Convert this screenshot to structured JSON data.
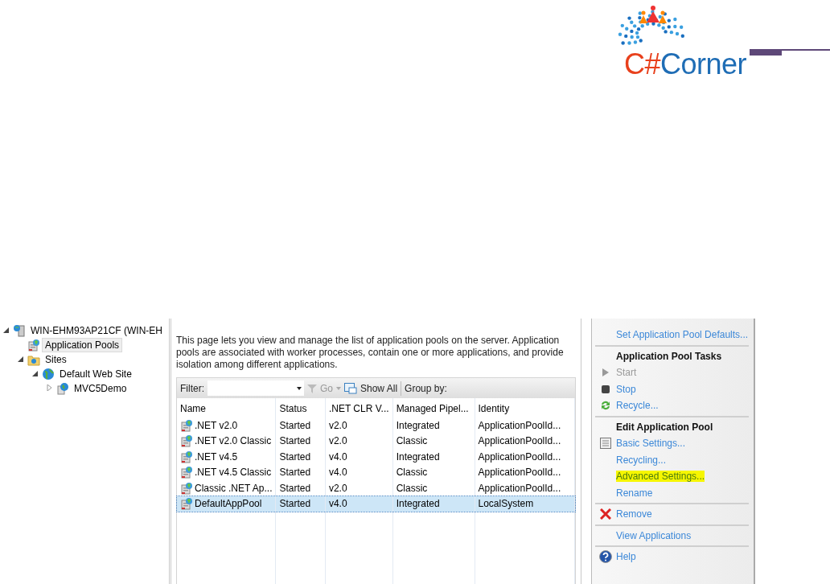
{
  "logo": {
    "prefix": "C#",
    "name": "Corner"
  },
  "tree": [
    {
      "label": "WIN-EHM93AP21CF (WIN-EH",
      "kind": "server",
      "expanded": true,
      "selected": false,
      "children": [
        {
          "label": "Application Pools",
          "kind": "pools",
          "selected": false,
          "highlighted": true
        },
        {
          "label": "Sites",
          "kind": "folder",
          "expanded": true,
          "selected": false,
          "children": [
            {
              "label": "Default Web Site",
              "kind": "globe",
              "expanded": true,
              "selected": false,
              "children": [
                {
                  "label": "MVC5Demo",
                  "kind": "app",
                  "expanded": false,
                  "selected": false
                }
              ]
            }
          ]
        }
      ]
    }
  ],
  "description": "This page lets you view and manage the list of application pools on the server. Application pools are associated with worker processes, contain one or more applications, and provide isolation among different applications.",
  "toolbar": {
    "filter_label": "Filter:",
    "go": "Go",
    "show_all": "Show All",
    "group_by": "Group by:"
  },
  "table": {
    "columns": [
      "Name",
      "Status",
      ".NET CLR V...",
      "Managed Pipel...",
      "Identity"
    ],
    "rows": [
      {
        "cells": [
          ".NET v2.0",
          "Started",
          "v2.0",
          "Integrated",
          "ApplicationPoolId..."
        ],
        "selected": false
      },
      {
        "cells": [
          ".NET v2.0 Classic",
          "Started",
          "v2.0",
          "Classic",
          "ApplicationPoolId..."
        ],
        "selected": false
      },
      {
        "cells": [
          ".NET v4.5",
          "Started",
          "v4.0",
          "Integrated",
          "ApplicationPoolId..."
        ],
        "selected": false
      },
      {
        "cells": [
          ".NET v4.5 Classic",
          "Started",
          "v4.0",
          "Classic",
          "ApplicationPoolId..."
        ],
        "selected": false
      },
      {
        "cells": [
          "Classic .NET Ap...",
          "Started",
          "v2.0",
          "Classic",
          "ApplicationPoolId..."
        ],
        "selected": false
      },
      {
        "cells": [
          "DefaultAppPool",
          "Started",
          "v4.0",
          "Integrated",
          "LocalSystem"
        ],
        "selected": true
      }
    ]
  },
  "actions": [
    {
      "kind": "link",
      "label": "Set Application Pool Defaults...",
      "disabled": false,
      "highlighted": false
    },
    {
      "kind": "separator"
    },
    {
      "kind": "header",
      "label": "Application Pool Tasks"
    },
    {
      "kind": "start",
      "label": "Start",
      "disabled": true,
      "highlighted": false
    },
    {
      "kind": "stop",
      "label": "Stop",
      "disabled": false,
      "highlighted": false
    },
    {
      "kind": "recycle",
      "label": "Recycle...",
      "disabled": false,
      "highlighted": false
    },
    {
      "kind": "separator"
    },
    {
      "kind": "header",
      "label": "Edit Application Pool"
    },
    {
      "kind": "settings",
      "label": "Basic Settings...",
      "disabled": false,
      "highlighted": false
    },
    {
      "kind": "link",
      "label": "Recycling...",
      "disabled": false,
      "highlighted": false
    },
    {
      "kind": "link",
      "label": "Advanced Settings...",
      "disabled": false,
      "highlighted": true
    },
    {
      "kind": "link",
      "label": "Rename",
      "disabled": false,
      "highlighted": false
    },
    {
      "kind": "separator"
    },
    {
      "kind": "remove",
      "label": "Remove",
      "disabled": false,
      "highlighted": false
    },
    {
      "kind": "separator"
    },
    {
      "kind": "link",
      "label": "View Applications",
      "disabled": false,
      "highlighted": false
    },
    {
      "kind": "separator"
    },
    {
      "kind": "help",
      "label": "Help",
      "disabled": false,
      "highlighted": false
    }
  ]
}
